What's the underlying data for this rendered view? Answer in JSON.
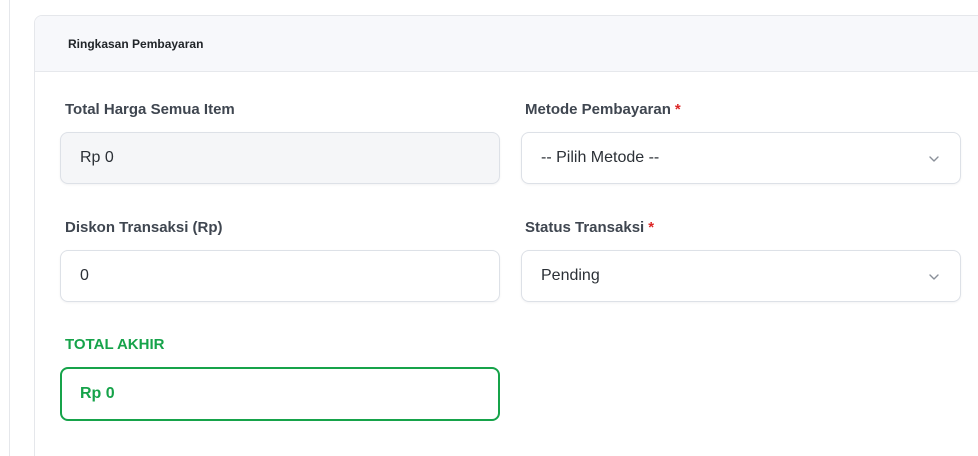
{
  "card": {
    "title": "Ringkasan Pembayaran"
  },
  "fields": {
    "total_harga": {
      "label": "Total Harga Semua Item",
      "value": "Rp 0"
    },
    "metode_pembayaran": {
      "label": "Metode Pembayaran",
      "required_mark": "*",
      "value": "-- Pilih Metode --",
      "icon": "chevron-down-icon"
    },
    "diskon": {
      "label": "Diskon Transaksi (Rp)",
      "value": "0"
    },
    "status_transaksi": {
      "label": "Status Transaksi",
      "required_mark": "*",
      "value": "Pending",
      "icon": "chevron-down-icon"
    },
    "total_akhir": {
      "label": "TOTAL AKHIR",
      "value": "Rp 0"
    }
  },
  "colors": {
    "accent_green": "#16a34a",
    "required_red": "#dc2626",
    "border": "#dde1e7",
    "header_bg": "#f7f8fb"
  }
}
